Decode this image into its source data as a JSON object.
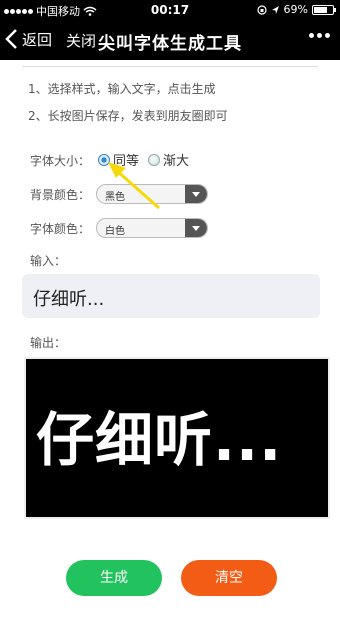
{
  "status_bar": {
    "carrier": "中国移动",
    "time": "00:17",
    "battery": "69%"
  },
  "nav": {
    "back_label": "返回",
    "close_label": "关闭",
    "title": "尖叫字体生成工具"
  },
  "instructions": {
    "line1": "1、选择样式，输入文字，点击生成",
    "line2": "2、长按图片保存，发表到朋友圈即可"
  },
  "form": {
    "font_size_label": "字体大小：",
    "font_size_options": [
      "同等",
      "渐大"
    ],
    "font_size_selected": "同等",
    "bg_color_label": "背景颜色：",
    "bg_color_value": "黑色",
    "font_color_label": "字体颜色：",
    "font_color_value": "白色",
    "input_label": "输入：",
    "input_value": "仔细听...",
    "output_label": "输出：",
    "output_text": "仔细听..."
  },
  "buttons": {
    "generate": "生成",
    "clear": "清空"
  },
  "colors": {
    "generate_button": "#22c35e",
    "clear_button": "#f25c14",
    "annotation_arrow": "#f5d90a"
  }
}
